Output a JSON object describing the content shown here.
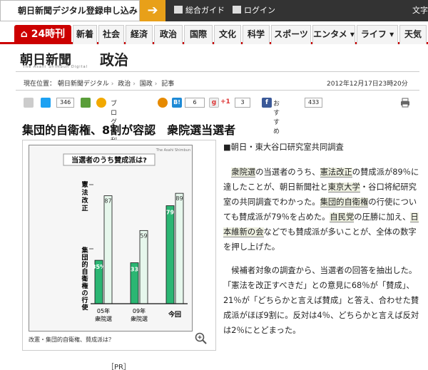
{
  "topbar": {
    "register_label": "朝日新聞デジタル登録申し込み",
    "guide_label": "総合ガイド",
    "login_label": "ログイン",
    "moji_label": "文字"
  },
  "nav": {
    "home_label": "24時刊",
    "items": [
      "新着",
      "社会",
      "経済",
      "政治",
      "国際",
      "文化",
      "科学",
      "スポーツ",
      "エンタメ ▾",
      "ライフ ▾",
      "天気"
    ]
  },
  "header": {
    "logo": "朝日新聞",
    "logo_sub": "The Asahi Shimbun Digital",
    "section": "政治"
  },
  "breadcrumb": {
    "prefix": "現在位置：",
    "items": [
      "朝日新聞デジタル",
      "政治",
      "国政",
      "記事"
    ],
    "date": "2012年12月17日23時20分"
  },
  "social": {
    "twitter_count": "346",
    "blog_label": "ブログに利用",
    "hatena_count": "6",
    "gplus_label": "+1",
    "gplus_count": "3",
    "facebook_label": "おすすめ",
    "facebook_count": "433"
  },
  "article": {
    "headline": "集団的自衛権、8割が容認　衆院選当選者",
    "lead": "■朝日・東大谷口研究室共同調査",
    "p1": [
      {
        "t": "衆院選",
        "link": true
      },
      {
        "t": "の当選者のうち、"
      },
      {
        "t": "憲法改正",
        "link": true
      },
      {
        "t": "の賛成派が89％に達したことが、朝日新聞社と"
      },
      {
        "t": "東京大学",
        "link": true
      },
      {
        "t": "・谷口将紀研究室の共同調査でわかった。"
      },
      {
        "t": "集団的自衛権",
        "link": true
      },
      {
        "t": "の行使についても賛成派が79％を占めた。"
      },
      {
        "t": "自民党",
        "link": true
      },
      {
        "t": "の圧勝に加え、"
      },
      {
        "t": "日本維新の会",
        "link": true
      },
      {
        "t": "などでも賛成派が多いことが、全体の数字を押し上げた。"
      }
    ],
    "p2": "候補者対象の調査から、当選者の回答を抽出した。「憲法を改正すべきだ」との意見に68％が「賛成」、21％が「どちらかと言えば賛成」と答え、合わせた賛成派がほぼ9割に。反対は4％、どちらかと言えば反対は2％にとどまった。",
    "pr": "［PR］"
  },
  "chart": {
    "credit": "The Asahi Shimbun",
    "caption": "改憲・集団的自衛権、賛成派は？",
    "accent": "#2bb673",
    "light": "#e6f7ec"
  },
  "chart_data": {
    "type": "bar",
    "title": "当選者のうち賛成派は?",
    "categories": [
      "05年衆院選",
      "09年衆院選",
      "今回"
    ],
    "series": [
      {
        "name": "集団的自衛権の行使",
        "values": [
          35,
          33,
          79
        ]
      },
      {
        "name": "憲法改正",
        "values": [
          87,
          59,
          89
        ]
      }
    ],
    "ylim": [
      0,
      100
    ],
    "grid": false,
    "legend": "vertical labels at left",
    "bar_labels": [
      "35%",
      "87",
      "33",
      "59",
      "79",
      "89"
    ]
  }
}
